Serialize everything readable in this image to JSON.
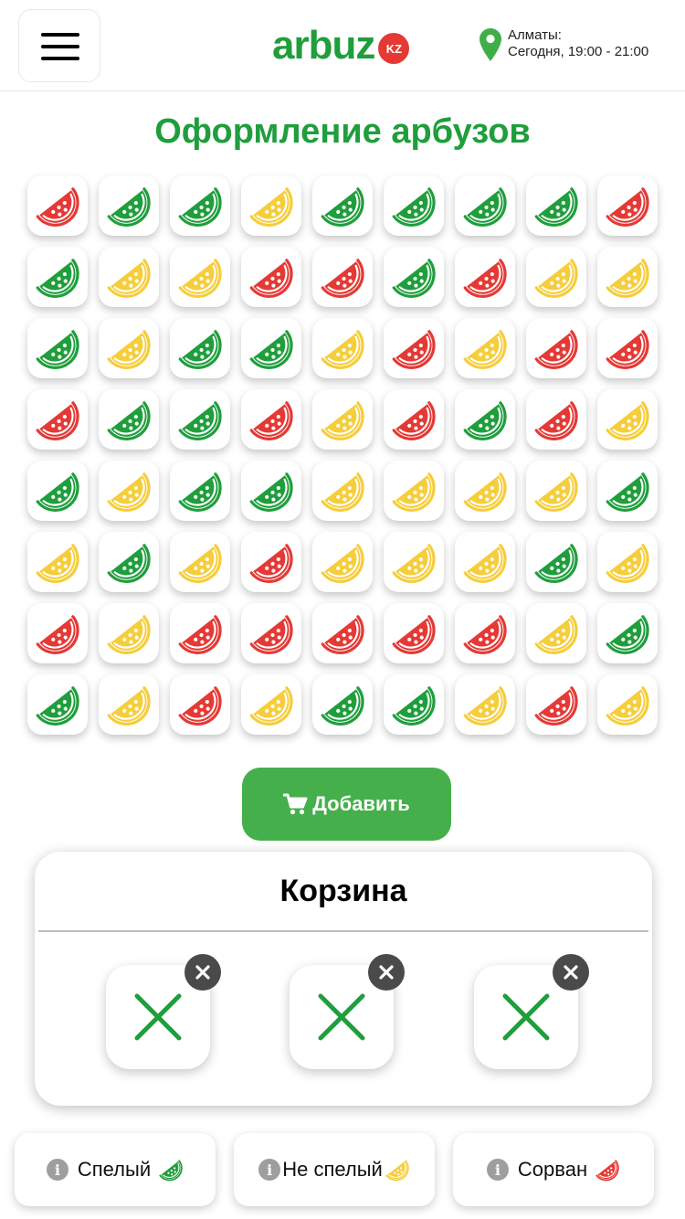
{
  "header": {
    "logo_text": "arbuz",
    "logo_badge": "KZ",
    "location_city": "Алматы:",
    "location_time": "Сегодня, 19:00 - 21:00",
    "brand_color": "#1f9e3c"
  },
  "title": "Оформление арбузов",
  "colors": {
    "ripe": "#1f9e3c",
    "unripe": "#f6cd3a",
    "picked": "#e53935"
  },
  "grid": [
    [
      "picked",
      "ripe",
      "ripe",
      "unripe",
      "ripe",
      "ripe",
      "ripe",
      "ripe",
      "picked"
    ],
    [
      "ripe",
      "unripe",
      "unripe",
      "picked",
      "picked",
      "ripe",
      "picked",
      "unripe",
      "unripe"
    ],
    [
      "ripe",
      "unripe",
      "ripe",
      "ripe",
      "unripe",
      "picked",
      "unripe",
      "picked",
      "picked"
    ],
    [
      "picked",
      "ripe",
      "ripe",
      "picked",
      "unripe",
      "picked",
      "ripe",
      "picked",
      "unripe"
    ],
    [
      "ripe",
      "unripe",
      "ripe",
      "ripe",
      "unripe",
      "unripe",
      "unripe",
      "unripe",
      "ripe"
    ],
    [
      "unripe",
      "ripe",
      "unripe",
      "picked",
      "unripe",
      "unripe",
      "unripe",
      "ripe",
      "unripe"
    ],
    [
      "picked",
      "unripe",
      "picked",
      "picked",
      "picked",
      "picked",
      "picked",
      "unripe",
      "ripe"
    ],
    [
      "ripe",
      "unripe",
      "picked",
      "unripe",
      "ripe",
      "ripe",
      "unripe",
      "picked",
      "unripe"
    ]
  ],
  "add_button": {
    "label": "Добавить",
    "icon": "cart-icon"
  },
  "cart": {
    "title": "Корзина",
    "slots": [
      {
        "content": "empty-x-icon"
      },
      {
        "content": "empty-x-icon"
      },
      {
        "content": "empty-x-icon"
      }
    ]
  },
  "legend": [
    {
      "label": "Спелый",
      "type": "ripe"
    },
    {
      "label": "Не спелый",
      "type": "unripe"
    },
    {
      "label": "Сорван",
      "type": "picked"
    }
  ]
}
